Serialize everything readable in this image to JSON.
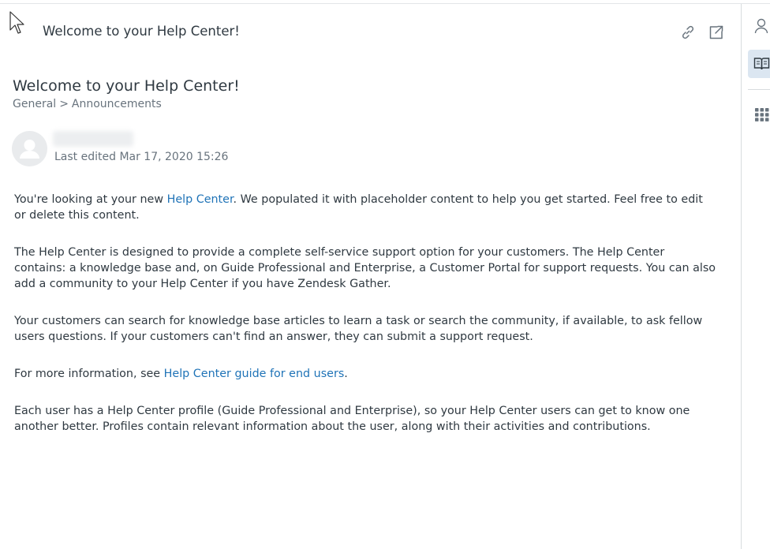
{
  "header": {
    "title": "Welcome to your Help Center!",
    "link_icon": "link-icon",
    "open_icon": "external-link-icon"
  },
  "article": {
    "title": "Welcome to your Help Center!",
    "breadcrumb": [
      "General",
      "Announcements"
    ],
    "breadcrumb_separator": ">",
    "last_edited": "Last edited Mar 17, 2020 15:26",
    "paragraphs": {
      "p1_pre": "You're looking at your new ",
      "p1_link": "Help Center",
      "p1_post": ". We populated it with placeholder content to help you get started. Feel free to edit or delete this content.",
      "p2": "The Help Center is designed to provide a complete self-service support option for your customers. The Help Center contains: a knowledge base and, on Guide Professional and Enterprise, a Customer Portal for support requests. You can also add a community to your Help Center if you have Zendesk Gather.",
      "p3": "Your customers can search for knowledge base articles to learn a task or search the community, if available, to ask fellow users questions. If your customers can't find an answer, they can submit a support request.",
      "p4_pre": "For more information, see ",
      "p4_link": "Help Center guide for end users",
      "p4_post": ".",
      "p5": "Each user has a Help Center profile (Guide Professional and Enterprise), so your Help Center users can get to know one another better. Profiles contain relevant information about the user, along with their activities and contributions."
    }
  },
  "sidebar": {
    "icons": [
      "user-icon",
      "knowledge-book-icon",
      "apps-grid-icon"
    ]
  },
  "colors": {
    "link": "#1f73b7",
    "text": "#2f3941",
    "muted": "#68737d",
    "active_bg": "#dbe6f1"
  }
}
